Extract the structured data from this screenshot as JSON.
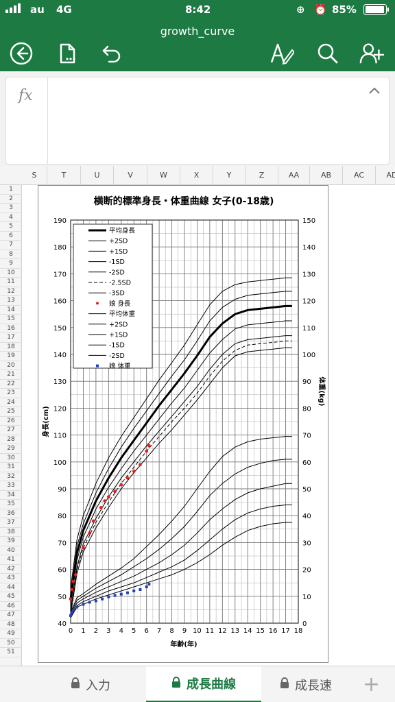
{
  "status": {
    "carrier": "au",
    "network": "4G",
    "time": "8:42",
    "battery": "85%"
  },
  "app": {
    "title": "growth_curve"
  },
  "toolbar": {
    "icons": [
      "back-icon",
      "file-icon",
      "undo-icon",
      "text-edit-icon",
      "search-icon",
      "add-user-icon"
    ]
  },
  "formula": {
    "label": "fx",
    "value": ""
  },
  "columns": [
    "S",
    "T",
    "U",
    "V",
    "W",
    "X",
    "Y",
    "Z",
    "AA",
    "AB",
    "AC",
    "AD"
  ],
  "rows": [
    "1",
    "2",
    "3",
    "4",
    "5",
    "6",
    "7",
    "8",
    "9",
    "10",
    "11",
    "12",
    "13",
    "14",
    "15",
    "16",
    "17",
    "18",
    "19",
    "20",
    "21",
    "22",
    "23",
    "24",
    "25",
    "26",
    "27",
    "28",
    "29",
    "30",
    "31",
    "32",
    "33",
    "34",
    "35",
    "36",
    "37",
    "38",
    "39",
    "40",
    "41",
    "42",
    "43",
    "44",
    "45",
    "46",
    "47",
    "48",
    "49",
    "50",
    "51"
  ],
  "chart_data": {
    "type": "line",
    "title": "横断的標準身長・体重曲線 女子(0-18歳)",
    "xlabel": "年齢(年)",
    "ylabel": "身長(cm)",
    "y2label": "体重(kg)",
    "xlim": [
      0,
      18
    ],
    "ylim": [
      40,
      190
    ],
    "y2lim": [
      0,
      150
    ],
    "xticks": [
      "0",
      "1",
      "2",
      "3",
      "4",
      "5",
      "6",
      "7",
      "8",
      "9",
      "10",
      "11",
      "12",
      "13",
      "14",
      "15",
      "16",
      "17",
      "18"
    ],
    "yticks": [
      "40",
      "50",
      "60",
      "70",
      "80",
      "90",
      "100",
      "110",
      "120",
      "130",
      "140",
      "150",
      "160",
      "170",
      "180",
      "190"
    ],
    "y2ticks": [
      "0",
      "10",
      "20",
      "30",
      "40",
      "50",
      "60",
      "70",
      "80",
      "90",
      "100",
      "110",
      "120",
      "130",
      "140",
      "150"
    ],
    "grid": true,
    "legend_position": "top-left",
    "x": [
      0,
      0.5,
      1,
      2,
      3,
      4,
      5,
      6,
      7,
      8,
      9,
      10,
      11,
      12,
      13,
      14,
      15,
      16,
      17,
      17.5
    ],
    "series": [
      {
        "name": "平均身長",
        "axis": "left",
        "style": "thick",
        "values": [
          49,
          66,
          74.5,
          85.5,
          94,
          101.5,
          108,
          114.5,
          121,
          127,
          133,
          139.5,
          146.5,
          151.5,
          155,
          156.5,
          157,
          157.5,
          158,
          158
        ]
      },
      {
        "name": "+2SD",
        "axis": "left",
        "style": "solid",
        "values": [
          53,
          71,
          80,
          92,
          101.5,
          109.5,
          116.5,
          123.5,
          130.5,
          137,
          143.5,
          151,
          158.5,
          163.5,
          166,
          167,
          167.5,
          168,
          168.5,
          168.5
        ]
      },
      {
        "name": "+1SD",
        "axis": "left",
        "style": "solid",
        "values": [
          51,
          68.5,
          77,
          88.5,
          97.5,
          105.5,
          112.5,
          119,
          125.5,
          132,
          138,
          145,
          152.5,
          157.5,
          160.5,
          162,
          162.5,
          163,
          163.5,
          163.5
        ]
      },
      {
        "name": "-1SD",
        "axis": "left",
        "style": "solid",
        "values": [
          47,
          63.5,
          72,
          82.5,
          90.5,
          97.5,
          104,
          110,
          116,
          122,
          127.5,
          134,
          140.5,
          145.5,
          149.5,
          151,
          151.5,
          152,
          152.5,
          152.5
        ]
      },
      {
        "name": "-2SD",
        "axis": "left",
        "style": "solid",
        "values": [
          45,
          61,
          69.5,
          79,
          87,
          94,
          100,
          106,
          111.5,
          117,
          122.5,
          128,
          134.5,
          140,
          144,
          145.5,
          146,
          146.5,
          147,
          147
        ]
      },
      {
        "name": "-2.5SD",
        "axis": "left",
        "style": "dashed",
        "values": [
          44,
          60,
          68,
          77.5,
          85,
          92,
          98,
          104,
          109.5,
          115,
          120,
          125.5,
          132,
          137.5,
          141.5,
          143.5,
          144,
          144.5,
          145,
          145
        ]
      },
      {
        "name": "-3SD",
        "axis": "left",
        "style": "solid",
        "values": [
          43,
          58.5,
          66.5,
          75.5,
          83,
          90,
          96,
          101.5,
          107,
          112,
          117.5,
          123,
          129,
          135,
          139.5,
          141,
          141.5,
          142,
          142.5,
          142.5
        ]
      },
      {
        "name": "娘 身長",
        "axis": "left",
        "style": "marker-circle",
        "color": "#e02020",
        "points": [
          [
            0,
            49
          ],
          [
            0.1,
            52.5
          ],
          [
            0.2,
            55.5
          ],
          [
            0.4,
            58
          ],
          [
            1,
            68
          ],
          [
            1.5,
            73.5
          ],
          [
            1.8,
            78
          ],
          [
            2.4,
            83
          ],
          [
            2.7,
            85.5
          ],
          [
            3,
            87
          ],
          [
            3.5,
            89
          ],
          [
            4,
            91.5
          ],
          [
            4.5,
            94
          ],
          [
            5,
            96.5
          ],
          [
            5.5,
            99
          ],
          [
            6,
            104
          ],
          [
            6.2,
            106
          ]
        ]
      },
      {
        "name": "平均体重",
        "axis": "right",
        "style": "solid",
        "values": [
          3,
          7.5,
          9,
          11.5,
          13.5,
          15.5,
          17.5,
          20,
          22.5,
          25.5,
          29,
          33.5,
          38.5,
          42.5,
          46,
          48.5,
          50,
          51,
          52,
          52
        ]
      },
      {
        "name": "+2SD",
        "axis": "right",
        "style": "solid",
        "values": [
          4,
          9.5,
          11,
          14.5,
          17.5,
          20.5,
          24,
          28.5,
          33,
          38,
          43.5,
          50,
          56.5,
          62,
          65.5,
          67.5,
          68.5,
          69,
          69.5,
          69.5
        ]
      },
      {
        "name": "+1SD",
        "axis": "right",
        "style": "solid",
        "values": [
          3.5,
          8.5,
          10,
          13,
          15.5,
          18,
          21,
          24,
          27.5,
          31.5,
          36,
          41.5,
          47.5,
          52,
          55.5,
          58,
          59.5,
          60.5,
          61,
          61
        ]
      },
      {
        "name": "-1SD",
        "axis": "right",
        "style": "solid",
        "values": [
          2.5,
          6.5,
          8,
          10,
          12,
          13.5,
          15,
          17,
          19,
          21,
          23.5,
          27,
          31,
          35,
          38.5,
          41,
          42.5,
          43.5,
          44,
          44
        ]
      },
      {
        "name": "-2SD",
        "axis": "right",
        "style": "solid",
        "values": [
          2,
          6,
          7,
          9,
          10.5,
          12,
          13.5,
          15,
          16.5,
          18,
          20,
          22.5,
          25.5,
          29,
          32,
          34.5,
          36,
          37,
          37.5,
          37.5
        ]
      },
      {
        "name": "娘 体重",
        "axis": "right",
        "style": "marker-square",
        "color": "#2040c0",
        "points": [
          [
            0,
            2.8
          ],
          [
            0.1,
            4
          ],
          [
            0.2,
            4.8
          ],
          [
            0.5,
            6
          ],
          [
            1,
            7
          ],
          [
            1.5,
            7.8
          ],
          [
            2,
            8.3
          ],
          [
            2.5,
            9
          ],
          [
            3,
            9.8
          ],
          [
            3.5,
            10.3
          ],
          [
            4,
            10.8
          ],
          [
            4.5,
            11.3
          ],
          [
            5,
            12
          ],
          [
            5.5,
            12.5
          ],
          [
            6,
            13.5
          ],
          [
            6.2,
            14.5
          ]
        ]
      }
    ]
  },
  "sheets": [
    {
      "label": "入力",
      "active": false
    },
    {
      "label": "成長曲線",
      "active": true
    },
    {
      "label": "成長速",
      "active": false
    }
  ],
  "add_sheet": "+"
}
